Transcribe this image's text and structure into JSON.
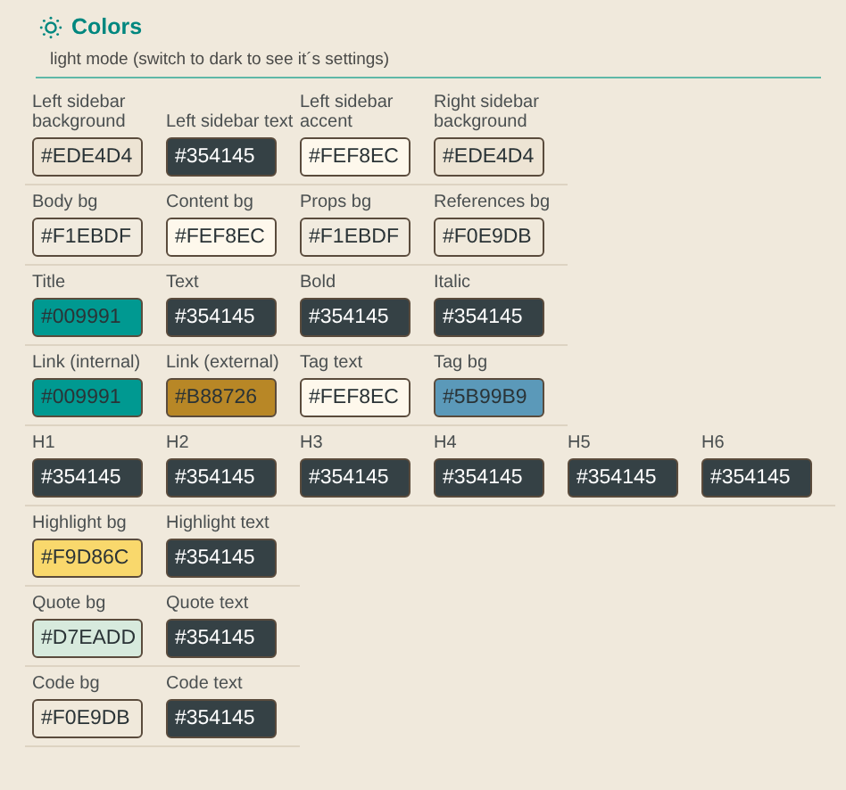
{
  "header": {
    "title": "Colors",
    "subtitle": "light mode (switch to dark to see it´s settings)"
  },
  "groups": [
    {
      "items": [
        {
          "label": "Left sidebar background",
          "value": "#EDE4D4",
          "color": "#ede4d4"
        },
        {
          "label": "Left sidebar text",
          "value": "#354145",
          "color": "#354145"
        },
        {
          "label": "Left sidebar accent",
          "value": "#FEF8EC",
          "color": "#fef8ec"
        },
        {
          "label": "Right sidebar background",
          "value": "#EDE4D4",
          "color": "#ede4d4"
        }
      ]
    },
    {
      "items": [
        {
          "label": "Body bg",
          "value": "#F1EBDF",
          "color": "#f1ebdf"
        },
        {
          "label": "Content bg",
          "value": "#FEF8EC",
          "color": "#fef8ec"
        },
        {
          "label": "Props bg",
          "value": "#F1EBDF",
          "color": "#f1ebdf"
        },
        {
          "label": "References bg",
          "value": "#F0E9DB",
          "color": "#f0e9db"
        }
      ]
    },
    {
      "items": [
        {
          "label": "Title",
          "value": "#009991",
          "color": "#009991"
        },
        {
          "label": "Text",
          "value": "#354145",
          "color": "#354145"
        },
        {
          "label": "Bold",
          "value": "#354145",
          "color": "#354145"
        },
        {
          "label": "Italic",
          "value": "#354145",
          "color": "#354145"
        }
      ]
    },
    {
      "items": [
        {
          "label": "Link (internal)",
          "value": "#009991",
          "color": "#009991"
        },
        {
          "label": "Link (external)",
          "value": "#B88726",
          "color": "#b88726"
        },
        {
          "label": "Tag text",
          "value": "#FEF8EC",
          "color": "#fef8ec"
        },
        {
          "label": "Tag bg",
          "value": "#5B99B9",
          "color": "#5b99b9"
        }
      ]
    },
    {
      "items": [
        {
          "label": "H1",
          "value": "#354145",
          "color": "#354145"
        },
        {
          "label": "H2",
          "value": "#354145",
          "color": "#354145"
        },
        {
          "label": "H3",
          "value": "#354145",
          "color": "#354145"
        },
        {
          "label": "H4",
          "value": "#354145",
          "color": "#354145"
        },
        {
          "label": "H5",
          "value": "#354145",
          "color": "#354145"
        },
        {
          "label": "H6",
          "value": "#354145",
          "color": "#354145"
        }
      ]
    },
    {
      "items": [
        {
          "label": "Highlight bg",
          "value": "#F9D86C",
          "color": "#f9d86c"
        },
        {
          "label": "Highlight text",
          "value": "#354145",
          "color": "#354145"
        }
      ]
    },
    {
      "items": [
        {
          "label": "Quote bg",
          "value": "#D7EADD",
          "color": "#d7eadd"
        },
        {
          "label": "Quote text",
          "value": "#354145",
          "color": "#354145"
        }
      ]
    },
    {
      "items": [
        {
          "label": "Code bg",
          "value": "#F0E9DB",
          "color": "#f0e9db"
        },
        {
          "label": "Code text",
          "value": "#354145",
          "color": "#354145"
        }
      ]
    }
  ]
}
